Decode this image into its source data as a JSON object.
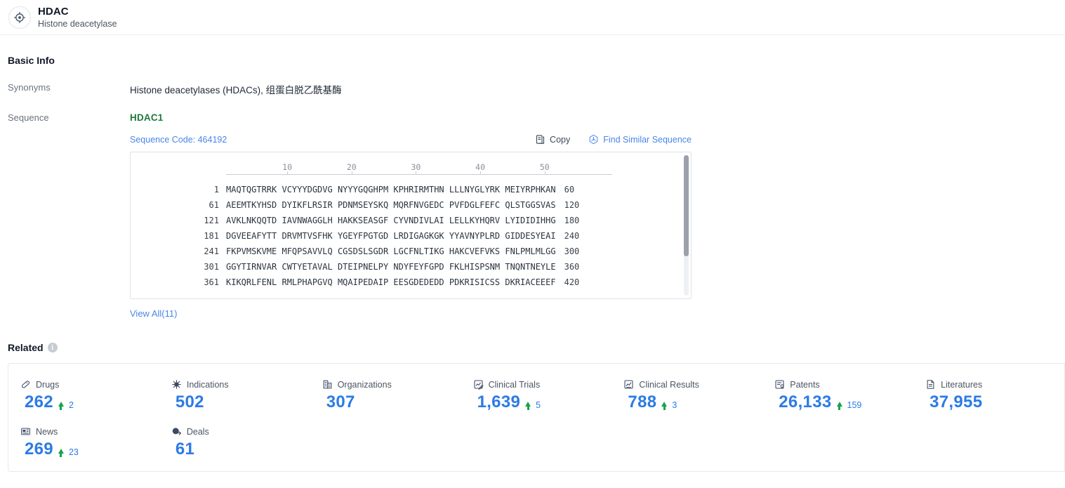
{
  "header": {
    "icon": "target-icon",
    "title": "HDAC",
    "subtitle": "Histone deacetylase"
  },
  "basic_info": {
    "section_title": "Basic Info",
    "rows": [
      {
        "label": "Synonyms",
        "value": "Histone deacetylases (HDACs), 组蛋白脱乙酰基酶"
      },
      {
        "label": "Sequence",
        "value": ""
      }
    ]
  },
  "sequence": {
    "name": "HDAC1",
    "code_label": "Sequence Code: 464192",
    "copy_label": "Copy",
    "find_similar_label": "Find Similar Sequence",
    "copy_icon": "copy-icon",
    "find_similar_icon": "hexagon-molecule-icon",
    "ruler_ticks": [
      "10",
      "20",
      "30",
      "40",
      "50"
    ],
    "lines": [
      {
        "start": "1",
        "chunks": "MAQTQGTRRK VCYYYDGDVG NYYYGQGHPM KPHRIRMTHN LLLNYGLYRK MEIYRPHKAN",
        "end": "60"
      },
      {
        "start": "61",
        "chunks": "AEEMTKYHSD DYIKFLRSIR PDNMSEYSKQ MQRFNVGEDC PVFDGLFEFC QLSTGGSVAS",
        "end": "120"
      },
      {
        "start": "121",
        "chunks": "AVKLNKQQTD IAVNWAGGLH HAKKSEASGF CYVNDIVLAI LELLKYHQRV LYIDIDIHHG",
        "end": "180"
      },
      {
        "start": "181",
        "chunks": "DGVEEAFYTT DRVMTVSFHK YGEYFPGTGD LRDIGAGKGK YYAVNYPLRD GIDDESYEAI",
        "end": "240"
      },
      {
        "start": "241",
        "chunks": "FKPVMSKVME MFQPSAVVLQ CGSDSLSGDR LGCFNLTIKG HAKCVEFVKS FNLPMLMLGG",
        "end": "300"
      },
      {
        "start": "301",
        "chunks": "GGYTIRNVAR CWTYETAVAL DTEIPNELPY NDYFEYFGPD FKLHISPSNM TNQNTNEYLE",
        "end": "360"
      },
      {
        "start": "361",
        "chunks": "KIKQRLFENL RMLPHAPGVQ MQAIPEDAIP EESGDEDEDD PDKRISICSS DKRIACEEEF",
        "end": "420"
      }
    ],
    "view_all_label": "View All(11)"
  },
  "related": {
    "section_title": "Related",
    "info_icon": "info-icon",
    "stats": [
      {
        "label": "Drugs",
        "icon": "pill-icon",
        "value": "262",
        "delta": "2"
      },
      {
        "label": "Indications",
        "icon": "virus-icon",
        "value": "502",
        "delta": ""
      },
      {
        "label": "Organizations",
        "icon": "building-icon",
        "value": "307",
        "delta": ""
      },
      {
        "label": "Clinical Trials",
        "icon": "clinical-trial-icon",
        "value": "1,639",
        "delta": "5"
      },
      {
        "label": "Clinical Results",
        "icon": "clinical-result-icon",
        "value": "788",
        "delta": "3"
      },
      {
        "label": "Patents",
        "icon": "patent-icon",
        "value": "26,133",
        "delta": "159"
      },
      {
        "label": "Literatures",
        "icon": "literature-icon",
        "value": "37,955",
        "delta": ""
      },
      {
        "label": "News",
        "icon": "news-icon",
        "value": "269",
        "delta": "23"
      },
      {
        "label": "Deals",
        "icon": "deal-icon",
        "value": "61",
        "delta": ""
      }
    ]
  },
  "colors": {
    "accent_blue": "#2c7be5",
    "link_blue": "#4a86e8",
    "sequence_green": "#1f7a3d",
    "delta_green": "#16a34a"
  }
}
